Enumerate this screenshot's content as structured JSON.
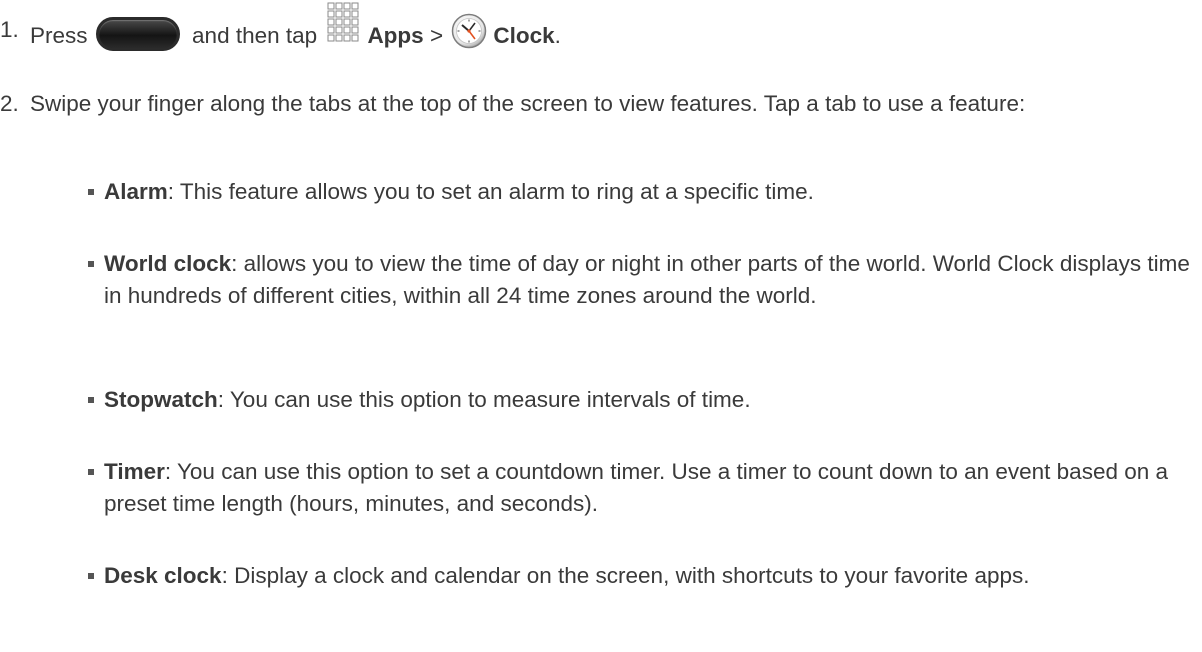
{
  "steps": [
    {
      "number": "1.",
      "press": "Press",
      "and_then_tap": "and then tap",
      "apps_label": "Apps",
      "separator": ">",
      "clock_label": "Clock",
      "end": "."
    },
    {
      "number": "2.",
      "text": "Swipe your finger along the tabs at the top of the screen to view features. Tap a tab to use a feature:"
    }
  ],
  "features": [
    {
      "name": "Alarm",
      "description": ": This feature allows you to set an alarm to ring at a specific time."
    },
    {
      "name": "World clock",
      "description": ": allows you to view the time of day or night in other parts of the world. World Clock displays time in hundreds of different cities, within all 24 time zones around the world."
    },
    {
      "name": "Stopwatch",
      "description": ": You can use this option to measure intervals of time."
    },
    {
      "name": "Timer",
      "description": ": You can use this option to set a countdown timer. Use a timer to count down to an event based on a preset time length (hours, minutes, and seconds)."
    },
    {
      "name": "Desk clock",
      "description": ": Display a clock and calendar on the screen, with shortcuts to your favorite apps."
    }
  ],
  "icons": {
    "home_button": "home-button-icon",
    "apps": "apps-grid-icon",
    "clock": "clock-app-icon"
  },
  "colors": {
    "text": "#3a3a3a",
    "bullet": "#555555"
  }
}
